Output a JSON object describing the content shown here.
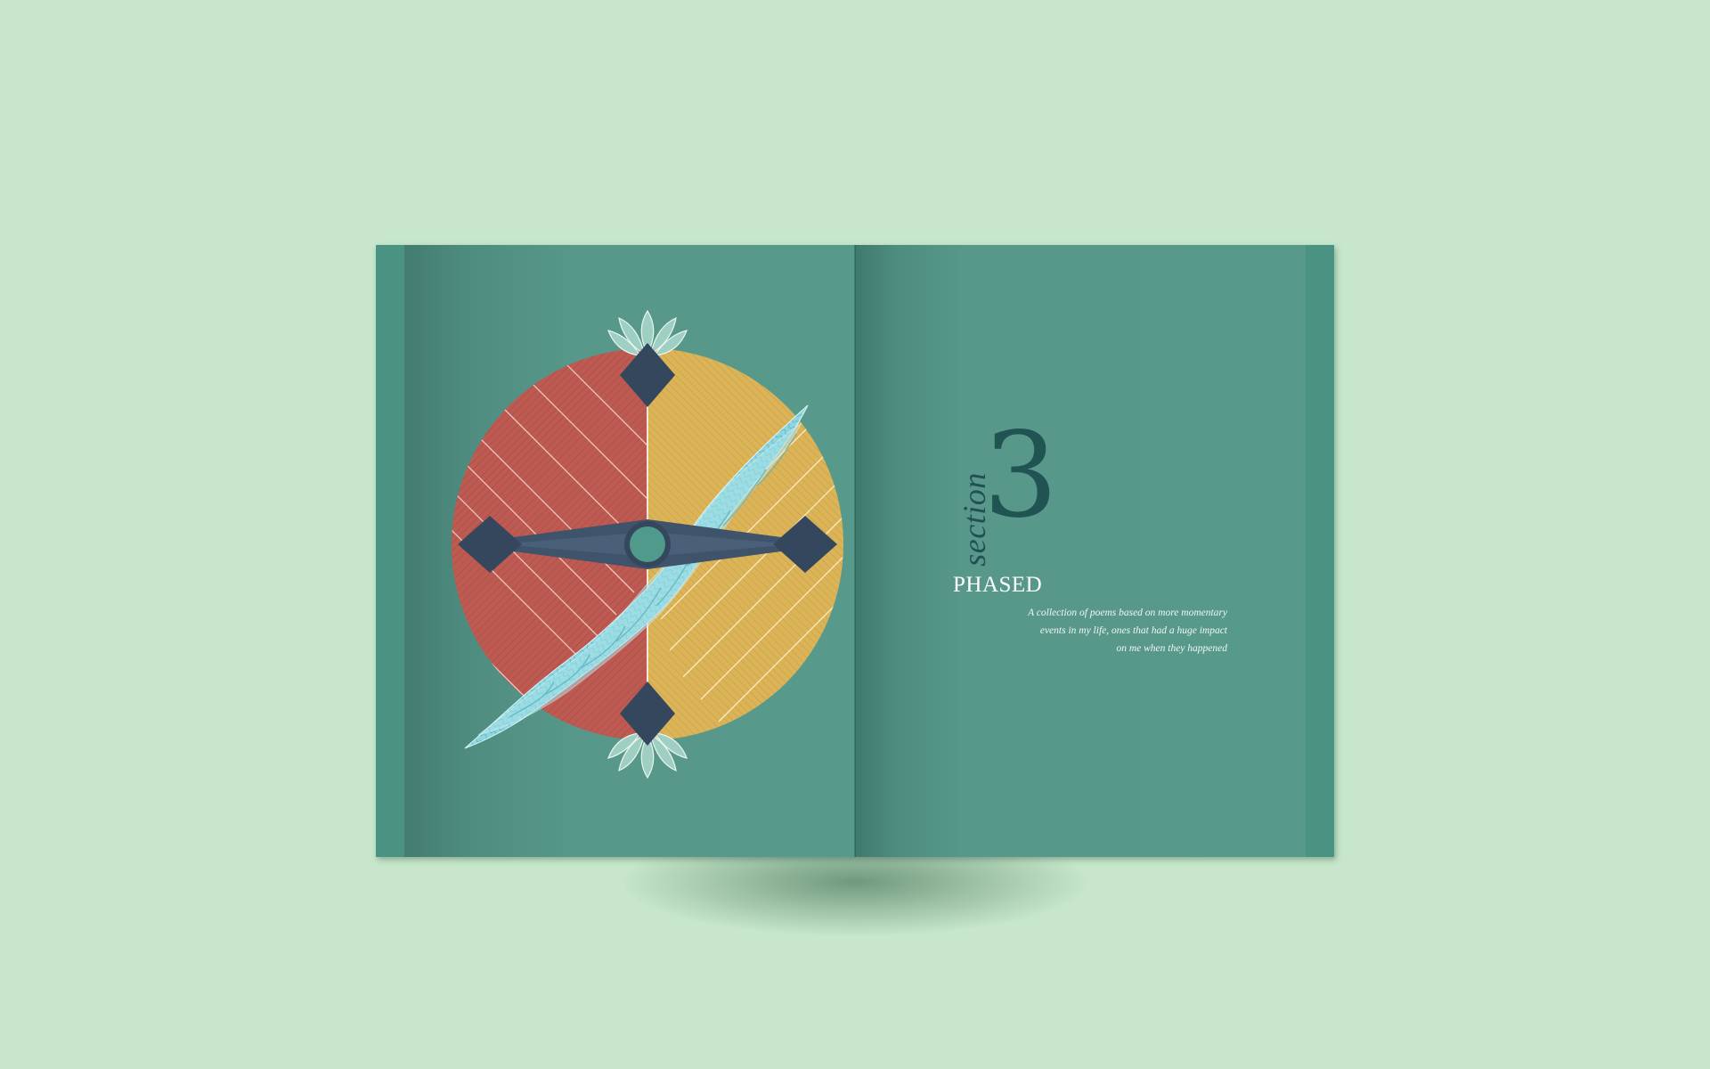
{
  "spread": {
    "section_label": "section",
    "section_number": "3",
    "title": "PHASED",
    "description_lines": [
      "A collection of poems based on more momentary",
      "events in my life, ones that had a huge impact",
      "on me when they happened"
    ]
  },
  "colors": {
    "background": "#c7e6cb",
    "page": "#57988a",
    "half_left": "#bd5a52",
    "half_right": "#dcb458",
    "compass": "#37495e",
    "braid": "#8fd7e0",
    "number_text": "#1f5453"
  },
  "illustration": {
    "icon": "compass-flower-icon"
  }
}
